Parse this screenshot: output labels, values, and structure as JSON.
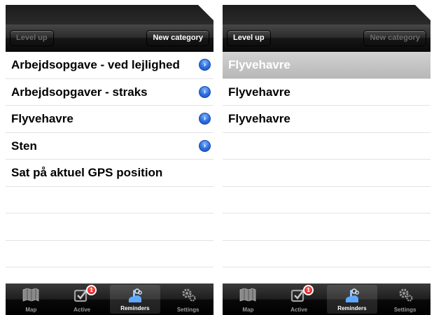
{
  "screens": [
    {
      "toolbar": {
        "left_button": "Level up",
        "left_disabled": true,
        "right_button": "New category",
        "right_disabled": false
      },
      "rows": [
        {
          "label": "Arbejdsopgave - ved lejlighed",
          "disclosure": true
        },
        {
          "label": "Arbejdsopgaver - straks",
          "disclosure": true
        },
        {
          "label": "Flyvehavre",
          "disclosure": true
        },
        {
          "label": "Sten",
          "disclosure": true
        },
        {
          "label": "Sat på aktuel GPS position",
          "disclosure": false
        }
      ]
    },
    {
      "toolbar": {
        "left_button": "Level up",
        "left_disabled": false,
        "right_button": "New category",
        "right_disabled": true
      },
      "rows": [
        {
          "label": "Flyvehavre",
          "selected": true
        },
        {
          "label": "Flyvehavre"
        },
        {
          "label": "Flyvehavre"
        }
      ]
    }
  ],
  "tabbar": {
    "tabs": [
      {
        "label": "Map",
        "icon": "map-icon"
      },
      {
        "label": "Active",
        "icon": "checkbox-icon",
        "badge": "1"
      },
      {
        "label": "Reminders",
        "icon": "reminders-icon",
        "active": true
      },
      {
        "label": "Settings",
        "icon": "gears-icon"
      }
    ]
  },
  "colors": {
    "disclosure_blue": "#2a6de0",
    "badge_red": "#d40000",
    "selected_row": "#c4c4c4"
  }
}
